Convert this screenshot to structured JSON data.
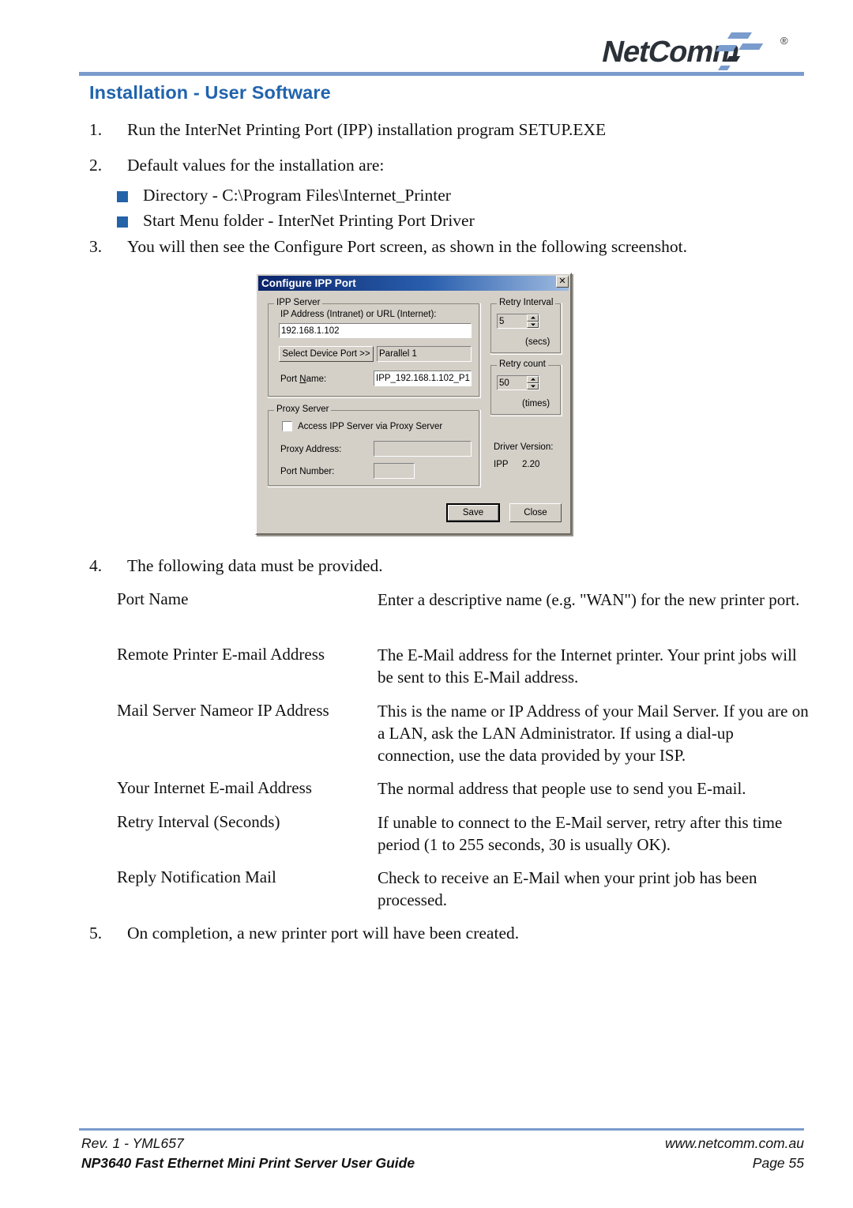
{
  "header": {
    "logo_text": "NetComm",
    "logo_mark": "registered-trademark",
    "title": "Installation - User Software",
    "accent_color": "#2163ad",
    "rule_color": "#7a9ccd"
  },
  "steps": [
    {
      "num": "1.",
      "text": "Run the InterNet Printing Port (IPP) installation program SETUP.EXE"
    },
    {
      "num": "2.",
      "text": "Default values for the installation are:"
    },
    {
      "num": "3.",
      "text": "You will then see the Configure Port screen, as shown in the following screenshot."
    },
    {
      "num": "4.",
      "text": "The following data must be provided."
    },
    {
      "num": "5.",
      "text": "On completion, a new printer port will have been created."
    }
  ],
  "bullets": [
    {
      "text": "Directory - C:\\Program Files\\Internet_Printer"
    },
    {
      "text": "Start Menu folder - InterNet Printing Port Driver"
    }
  ],
  "bullet_color": "#2463a8",
  "definitions": [
    {
      "term": "Port Name",
      "desc": "Enter a descriptive name (e.g. \"WAN\") for the new printer port."
    },
    {
      "term": "Remote Printer E-mail Address",
      "desc": "The E-Mail address for the Internet printer. Your print jobs will be sent to this E-Mail address."
    },
    {
      "term": "Mail Server Nameor IP Address",
      "desc": "This is the name or IP Address of your Mail Server. If you are on a LAN, ask the LAN Administrator. If using a dial-up connection, use the data provided by your ISP."
    },
    {
      "term": "Your Internet E-mail Address",
      "desc": "The normal address that people use to send you E-mail."
    },
    {
      "term": "Retry Interval (Seconds)",
      "desc": "If unable to connect to the E-Mail server, retry after this time period (1 to 255 seconds, 30 is usually OK)."
    },
    {
      "term": "Reply Notification Mail",
      "desc": "Check to receive an E-Mail when your print job has been processed."
    }
  ],
  "dialog": {
    "title": "Configure IPP Port",
    "close_label": "✕",
    "ipp_server": {
      "group_label": "IPP Server",
      "ip_label": "IP Address (Intranet) or URL (Internet):",
      "ip_value": "192.168.1.102",
      "select_device_port_button": "Select Device Port >>",
      "device_port_value": "Parallel 1",
      "port_name_label": "Port Name:",
      "port_name_label_pre": "Port ",
      "port_name_label_accel": "N",
      "port_name_label_post": "ame:",
      "port_name_value": "IPP_192.168.1.102_P1"
    },
    "proxy_server": {
      "group_label": "Proxy Server",
      "checkbox_label": "Access IPP Server via Proxy Server",
      "checkbox_checked": false,
      "proxy_address_label": "Proxy Address:",
      "proxy_address_value": "",
      "port_number_label": "Port Number:",
      "port_number_value": ""
    },
    "retry_interval": {
      "group_label": "Retry Interval",
      "value": "5",
      "unit": "(secs)"
    },
    "retry_count": {
      "group_label": "Retry count",
      "value": "50",
      "unit": "(times)"
    },
    "driver": {
      "label": "Driver Version:",
      "name": "IPP",
      "version": "2.20"
    },
    "buttons": {
      "save": "Save",
      "close": "Close"
    }
  },
  "footer": {
    "rev": "Rev. 1 - YML657",
    "guide": "NP3640 Fast Ethernet Mini Print Server User Guide",
    "website": "www.netcomm.com.au",
    "page": "Page 55"
  }
}
